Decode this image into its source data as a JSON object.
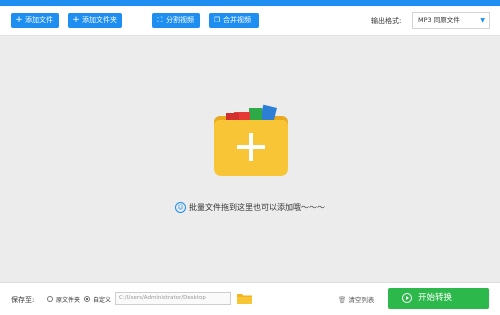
{
  "toolbar": {
    "add_file": "添加文件",
    "add_folder": "添加文件夹",
    "split_video": "分割视频",
    "merge_video": "合并视频",
    "output_format_label": "输出格式:",
    "output_format_value": "MP3  同原文件"
  },
  "main": {
    "drop_hint": "批量文件拖到这里也可以添加哦～～～"
  },
  "footer": {
    "save_to_label": "保存至:",
    "option_source_folder": "原文件夹",
    "option_custom": "自定义",
    "custom_selected": true,
    "output_path": "C:/Users/Administrator/Desktop",
    "clear_list": "清空列表",
    "start_convert": "开始转换"
  },
  "icons": {
    "add_file": "plus-icon",
    "add_folder": "plus-icon",
    "split_video": "split-icon",
    "merge_video": "merge-icon",
    "dropdown": "chevron-down-icon",
    "drop_area": "folder-plus-icon",
    "hint": "smile-icon",
    "browse": "folder-icon",
    "clear": "trash-icon",
    "start": "play-circle-icon"
  },
  "colors": {
    "accent": "#1e8ff0",
    "start_button": "#2cb84a",
    "folder": "#f7c536",
    "main_background": "#ececec"
  }
}
